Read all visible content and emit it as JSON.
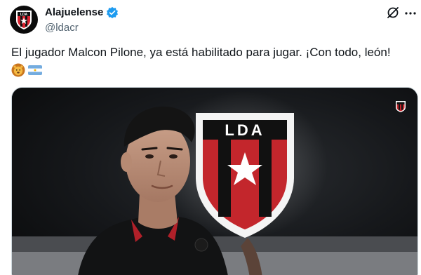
{
  "account": {
    "display_name": "Alajuelense",
    "handle": "@ldacr",
    "avatar_icon": "lda-crest-icon",
    "verified_color": "#1d9bf0"
  },
  "tweet": {
    "text": "El jugador Malcon Pilone, ya está habilitado para jugar. ¡Con todo, león!",
    "emojis": [
      "lion-face-emoji",
      "argentina-flag-emoji"
    ]
  },
  "media": {
    "type": "video",
    "logo_text": "LDA"
  },
  "colors": {
    "brand_red": "#d9232f",
    "brand_black": "#111111",
    "text_primary": "#0f1419",
    "text_secondary": "#536471"
  }
}
